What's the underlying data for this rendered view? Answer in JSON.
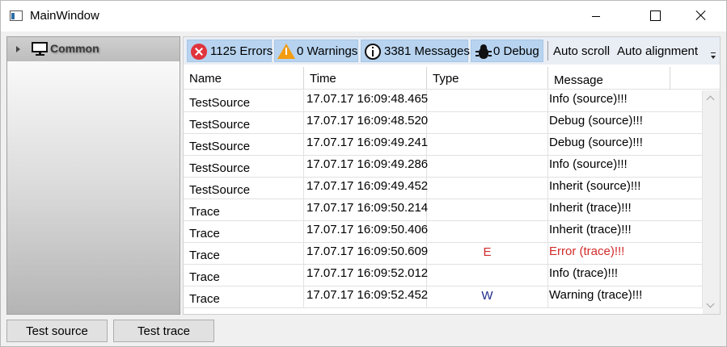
{
  "window": {
    "title": "MainWindow"
  },
  "tree": {
    "items": [
      {
        "label": "Common",
        "icon": "monitor-icon",
        "expanded": false
      }
    ]
  },
  "toolbar": {
    "errors_label": "1125 Errors",
    "warnings_label": "0 Warnings",
    "messages_label": "3381 Messages",
    "debug_label": "0 Debug",
    "auto_scroll_label": "Auto scroll",
    "auto_alignment_label": "Auto alignment",
    "icons": {
      "errors": "error-icon",
      "warnings": "warning-icon",
      "messages": "info-icon",
      "debug": "bug-icon"
    },
    "colors": {
      "active_bg": "#b7d3ef",
      "error": "#e0343d",
      "warning": "#f39c12"
    }
  },
  "grid": {
    "columns": [
      "Name",
      "Time",
      "Type",
      "Message"
    ],
    "rows": [
      {
        "name": "TestSource",
        "time": "17.07.17 16:09:48.465",
        "type": "",
        "message": "Info (source)!!!"
      },
      {
        "name": "TestSource",
        "time": "17.07.17 16:09:48.520",
        "type": "",
        "message": "Debug (source)!!!"
      },
      {
        "name": "TestSource",
        "time": "17.07.17 16:09:49.241",
        "type": "",
        "message": "Debug (source)!!!"
      },
      {
        "name": "TestSource",
        "time": "17.07.17 16:09:49.286",
        "type": "",
        "message": "Info (source)!!!"
      },
      {
        "name": "TestSource",
        "time": "17.07.17 16:09:49.452",
        "type": "",
        "message": "Inherit (source)!!!"
      },
      {
        "name": "Trace",
        "time": "17.07.17 16:09:50.214",
        "type": "",
        "message": "Inherit (trace)!!!"
      },
      {
        "name": "Trace",
        "time": "17.07.17 16:09:50.406",
        "type": "",
        "message": "Inherit (trace)!!!"
      },
      {
        "name": "Trace",
        "time": "17.07.17 16:09:50.609",
        "type": "E",
        "message": "Error (trace)!!!"
      },
      {
        "name": "Trace",
        "time": "17.07.17 16:09:52.012",
        "type": "",
        "message": "Info (trace)!!!"
      },
      {
        "name": "Trace",
        "time": "17.07.17 16:09:52.452",
        "type": "W",
        "message": "Warning (trace)!!!"
      }
    ],
    "type_colors": {
      "E": "#d22a2a",
      "W": "#1c2a8a"
    }
  },
  "buttons": {
    "test_source": "Test source",
    "test_trace": "Test trace"
  }
}
